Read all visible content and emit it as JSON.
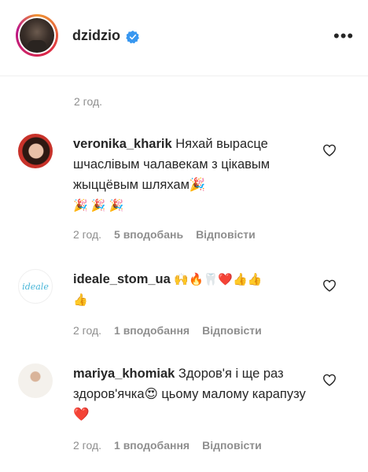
{
  "header": {
    "username": "dzidzio",
    "more_icon": "more-horizontal-icon"
  },
  "top_meta": {
    "time": "2 год."
  },
  "comments": [
    {
      "username": "veronika_kharik",
      "text": "Няхай вырасце шчаслівым чалавекам з цікавым жыццёвым шляхам🎉",
      "emoji_line": "🎉 🎉 🎉",
      "time": "2 год.",
      "likes": "5 вподобань",
      "reply": "Відповісти"
    },
    {
      "username": "ideale_stom_ua",
      "text": "🙌🔥🦷❤️👍👍",
      "emoji_line": "👍",
      "time": "2 год.",
      "likes": "1 вподобання",
      "reply": "Відповісти",
      "avatar_text": "ideale"
    },
    {
      "username": "mariya_khomiak",
      "text": "Здоров'я і ще раз здоров'ячка😍 цьому малому карапузу❤️",
      "time": "2 год.",
      "likes": "1 вподобання",
      "reply": "Відповісти"
    }
  ],
  "colors": {
    "verified": "#3897f0",
    "meta": "#8e8e8e",
    "heart_red": "#ed4956"
  }
}
